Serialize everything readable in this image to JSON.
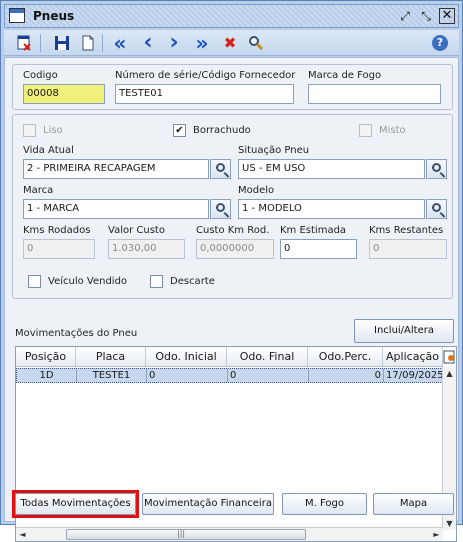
{
  "window": {
    "title": "Pneus"
  },
  "titlebar": {
    "restore_glyph": "⤢",
    "maximize_glyph": "⤡",
    "close_glyph": "✕"
  },
  "toolbar": {
    "icons": [
      "exit-icon",
      "save-icon",
      "new-document-icon",
      "first-record-icon",
      "previous-record-icon",
      "next-record-icon",
      "last-record-icon",
      "delete-icon",
      "search-icon",
      "help-icon"
    ],
    "glyphs": {
      "first": "«",
      "prev": "‹",
      "next": "›",
      "last": "»",
      "delete": "✖",
      "help": "?"
    },
    "colors": {
      "nav": "#1d4fb8",
      "delete": "#d9221a",
      "save": "#1b3f8f"
    }
  },
  "header": {
    "codigo_label": "Codigo",
    "codigo_value": "00008",
    "serie_label": "Número de série/Código Fornecedor",
    "serie_value": "TESTE01",
    "marca_fogo_label": "Marca de Fogo",
    "marca_fogo_value": ""
  },
  "details": {
    "liso_label": "Liso",
    "borrachudo_label": "Borrachudo",
    "borrachudo_mark": "✔",
    "misto_label": "Misto",
    "vida_atual_label": "Vida Atual",
    "vida_atual_value": "2  - PRIMEIRA RECAPAGEM",
    "situacao_label": "Situação Pneu",
    "situacao_value": "US - EM USO",
    "marca_label": "Marca",
    "marca_value": "1          - MARCA",
    "modelo_label": "Modelo",
    "modelo_value": "1          - MODELO",
    "kms_rodados_label": "Kms Rodados",
    "kms_rodados_value": "0",
    "valor_custo_label": "Valor Custo",
    "valor_custo_value": "1.030,00",
    "custo_km_label": "Custo Km Rod.",
    "custo_km_value": "0,0000000",
    "km_estimada_label": "Km Estimada",
    "km_estimada_value": "0",
    "kms_restantes_label": "Kms Restantes",
    "kms_restantes_value": "0",
    "veiculo_vendido_label": "Veículo Vendido",
    "descarte_label": "Descarte"
  },
  "movimentacoes": {
    "section_label": "Movimentações do Pneu",
    "incluir_button": "Inclui/Altera",
    "columns": [
      "Posição",
      "Placa",
      "Odo. Inicial",
      "Odo. Final",
      "Odo.Perc.",
      "Aplicação"
    ],
    "rows": [
      {
        "posicao": "1D",
        "placa": "TESTE1",
        "odo_inicial": "0",
        "odo_final": "0",
        "odo_perc": "0",
        "aplicacao": "17/09/2025"
      }
    ],
    "scroll_up": "▲",
    "scroll_down": "▼",
    "scroll_left": "◄",
    "scroll_right": "►",
    "thumb_grip": "|||"
  },
  "footer": {
    "todas_button": "Todas Movimentações",
    "financeira_button": "Movimentação Financeira",
    "fogo_button": "M. Fogo",
    "mapa_button": "Mapa",
    "highlight_color": "#e01010"
  }
}
